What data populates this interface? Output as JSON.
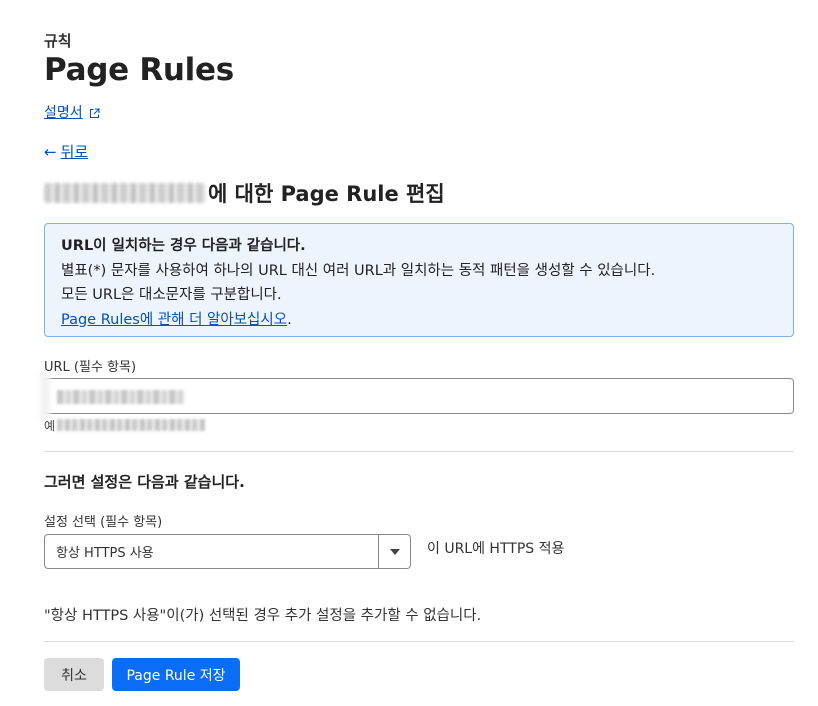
{
  "header": {
    "eyebrow": "규칙",
    "title": "Page Rules",
    "doc_link": "설명서",
    "back_link": "뒤로",
    "back_arrow": "←",
    "edit_heading_suffix": "에 대한 Page Rule 편집"
  },
  "info_box": {
    "title": "URL이 일치하는 경우 다음과 같습니다.",
    "line1": "별표(*) 문자를 사용하여 하나의 URL 대신 여러 URL과 일치하는 동적 패턴을 생성할 수 있습니다.",
    "line2": "모든 URL은 대소문자를 구분합니다.",
    "link_text": "Page Rules에 관해 더 알아보십시오",
    "link_suffix": "."
  },
  "url_field": {
    "label": "URL (필수 항목)",
    "example_prefix": "예"
  },
  "settings": {
    "heading": "그러면 설정은 다음과 같습니다.",
    "select_label": "설정 선택 (필수 항목)",
    "selected_value": "항상 HTTPS 사용",
    "description": "이 URL에 HTTPS 적용",
    "notice": "\"항상 HTTPS 사용\"이(가) 선택된 경우 추가 설정을 추가할 수 없습니다."
  },
  "actions": {
    "cancel_label": "취소",
    "save_label": "Page Rule 저장"
  },
  "colors": {
    "link": "#0051c3",
    "primary_button": "#0b6cf5",
    "info_bg": "#eef4fc",
    "info_border": "#7fb0e6"
  }
}
